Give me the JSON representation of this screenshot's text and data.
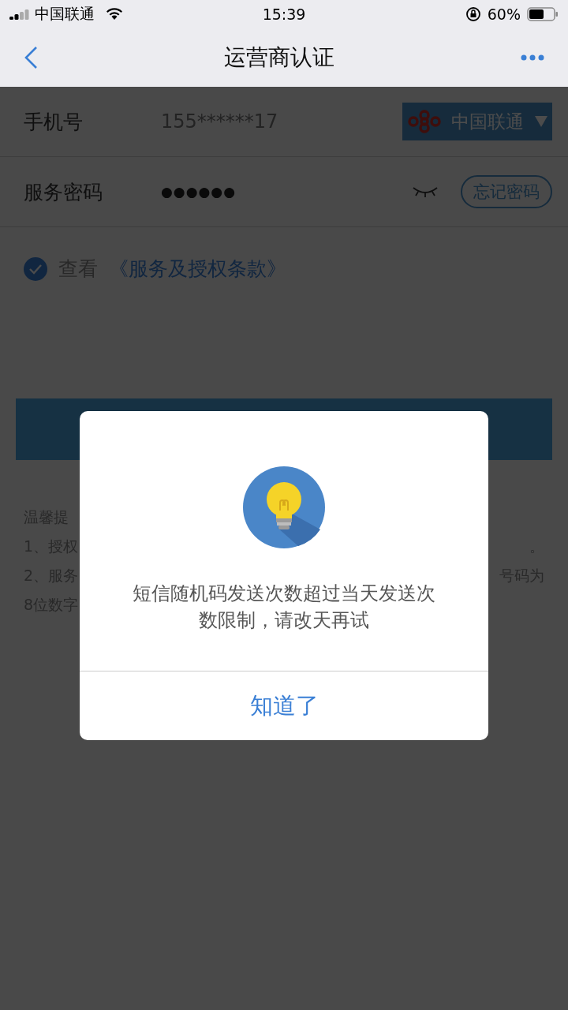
{
  "status_bar": {
    "carrier": "中国联通",
    "time": "15:39",
    "battery": "60%"
  },
  "nav": {
    "title": "运营商认证"
  },
  "form": {
    "phone": {
      "label": "手机号",
      "value": "155******17",
      "carrier": "中国联通"
    },
    "password": {
      "label": "服务密码",
      "value": "●●●●●●",
      "forgot": "忘记密码"
    },
    "agreement": {
      "checked": true,
      "text": "查看",
      "link": "《服务及授权条款》"
    }
  },
  "tips": [
    {
      "start": "温馨提"
    },
    {
      "start": "1、授权",
      "end": "。"
    },
    {
      "start": "2、服务",
      "end": "号码为"
    },
    {
      "start": "8位数字"
    }
  ],
  "dialog": {
    "message": "短信随机码发送次数超过当天发送次数限制，请改天再试",
    "button": "知道了"
  }
}
